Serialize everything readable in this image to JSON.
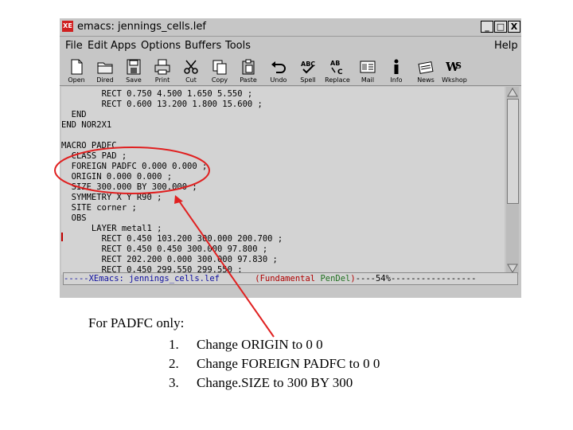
{
  "window": {
    "icon_text": "XE",
    "title": "emacs: jennings_cells.lef",
    "minimize": "_",
    "maximize": "□",
    "close": "X"
  },
  "menubar": {
    "items": [
      "File",
      "Edit",
      "Apps",
      "Options",
      "Buffers",
      "Tools"
    ],
    "help": "Help"
  },
  "toolbar": {
    "open": "Open",
    "dired": "Dired",
    "save": "Save",
    "print": "Print",
    "cut": "Cut",
    "copy": "Copy",
    "paste": "Paste",
    "undo": "Undo",
    "spell": "Spell",
    "replace": "Replace",
    "mail": "Mail",
    "info": "Info",
    "news": "News",
    "wkshop": "Wkshop"
  },
  "editor": {
    "lines": [
      "        RECT 0.750 4.500 1.650 5.550 ;",
      "        RECT 0.600 13.200 1.800 15.600 ;",
      "  END",
      "END NOR2X1",
      "",
      "MACRO PADFC",
      "  CLASS PAD ;",
      "  FOREIGN PADFC 0.000 0.000 ;",
      "  ORIGIN 0.000 0.000 ;",
      "  SIZE 300.000 BY 300.000 ;",
      "  SYMMETRY X Y R90 ;",
      "  SITE corner ;",
      "  OBS",
      "      LAYER metal1 ;",
      "        RECT 0.450 103.200 300.000 200.700 ;",
      "        RECT 0.450 0.450 300.000 97.800 ;",
      "        RECT 202.200 0.000 300.000 97.830 ;",
      "        RECT 0.450 299.550 299.550 ;"
    ]
  },
  "modeline": {
    "prefix": "-----",
    "buffer": "XEmacs: jennings_cells.lef",
    "gap": "       ",
    "mode_open": "(Fundamental ",
    "minor": "PenDel",
    "mode_close": ")",
    "position": "----54%-----------------"
  },
  "annotation": {
    "heading": "For PADFC only:",
    "items": [
      {
        "num": "1.",
        "text": "Change ORIGIN to 0 0"
      },
      {
        "num": "2.",
        "text": "Change FOREIGN PADFC to 0 0"
      },
      {
        "num": "3.",
        "text": "Change.SIZE to 300 BY 300"
      }
    ],
    "color": "#e02020"
  }
}
